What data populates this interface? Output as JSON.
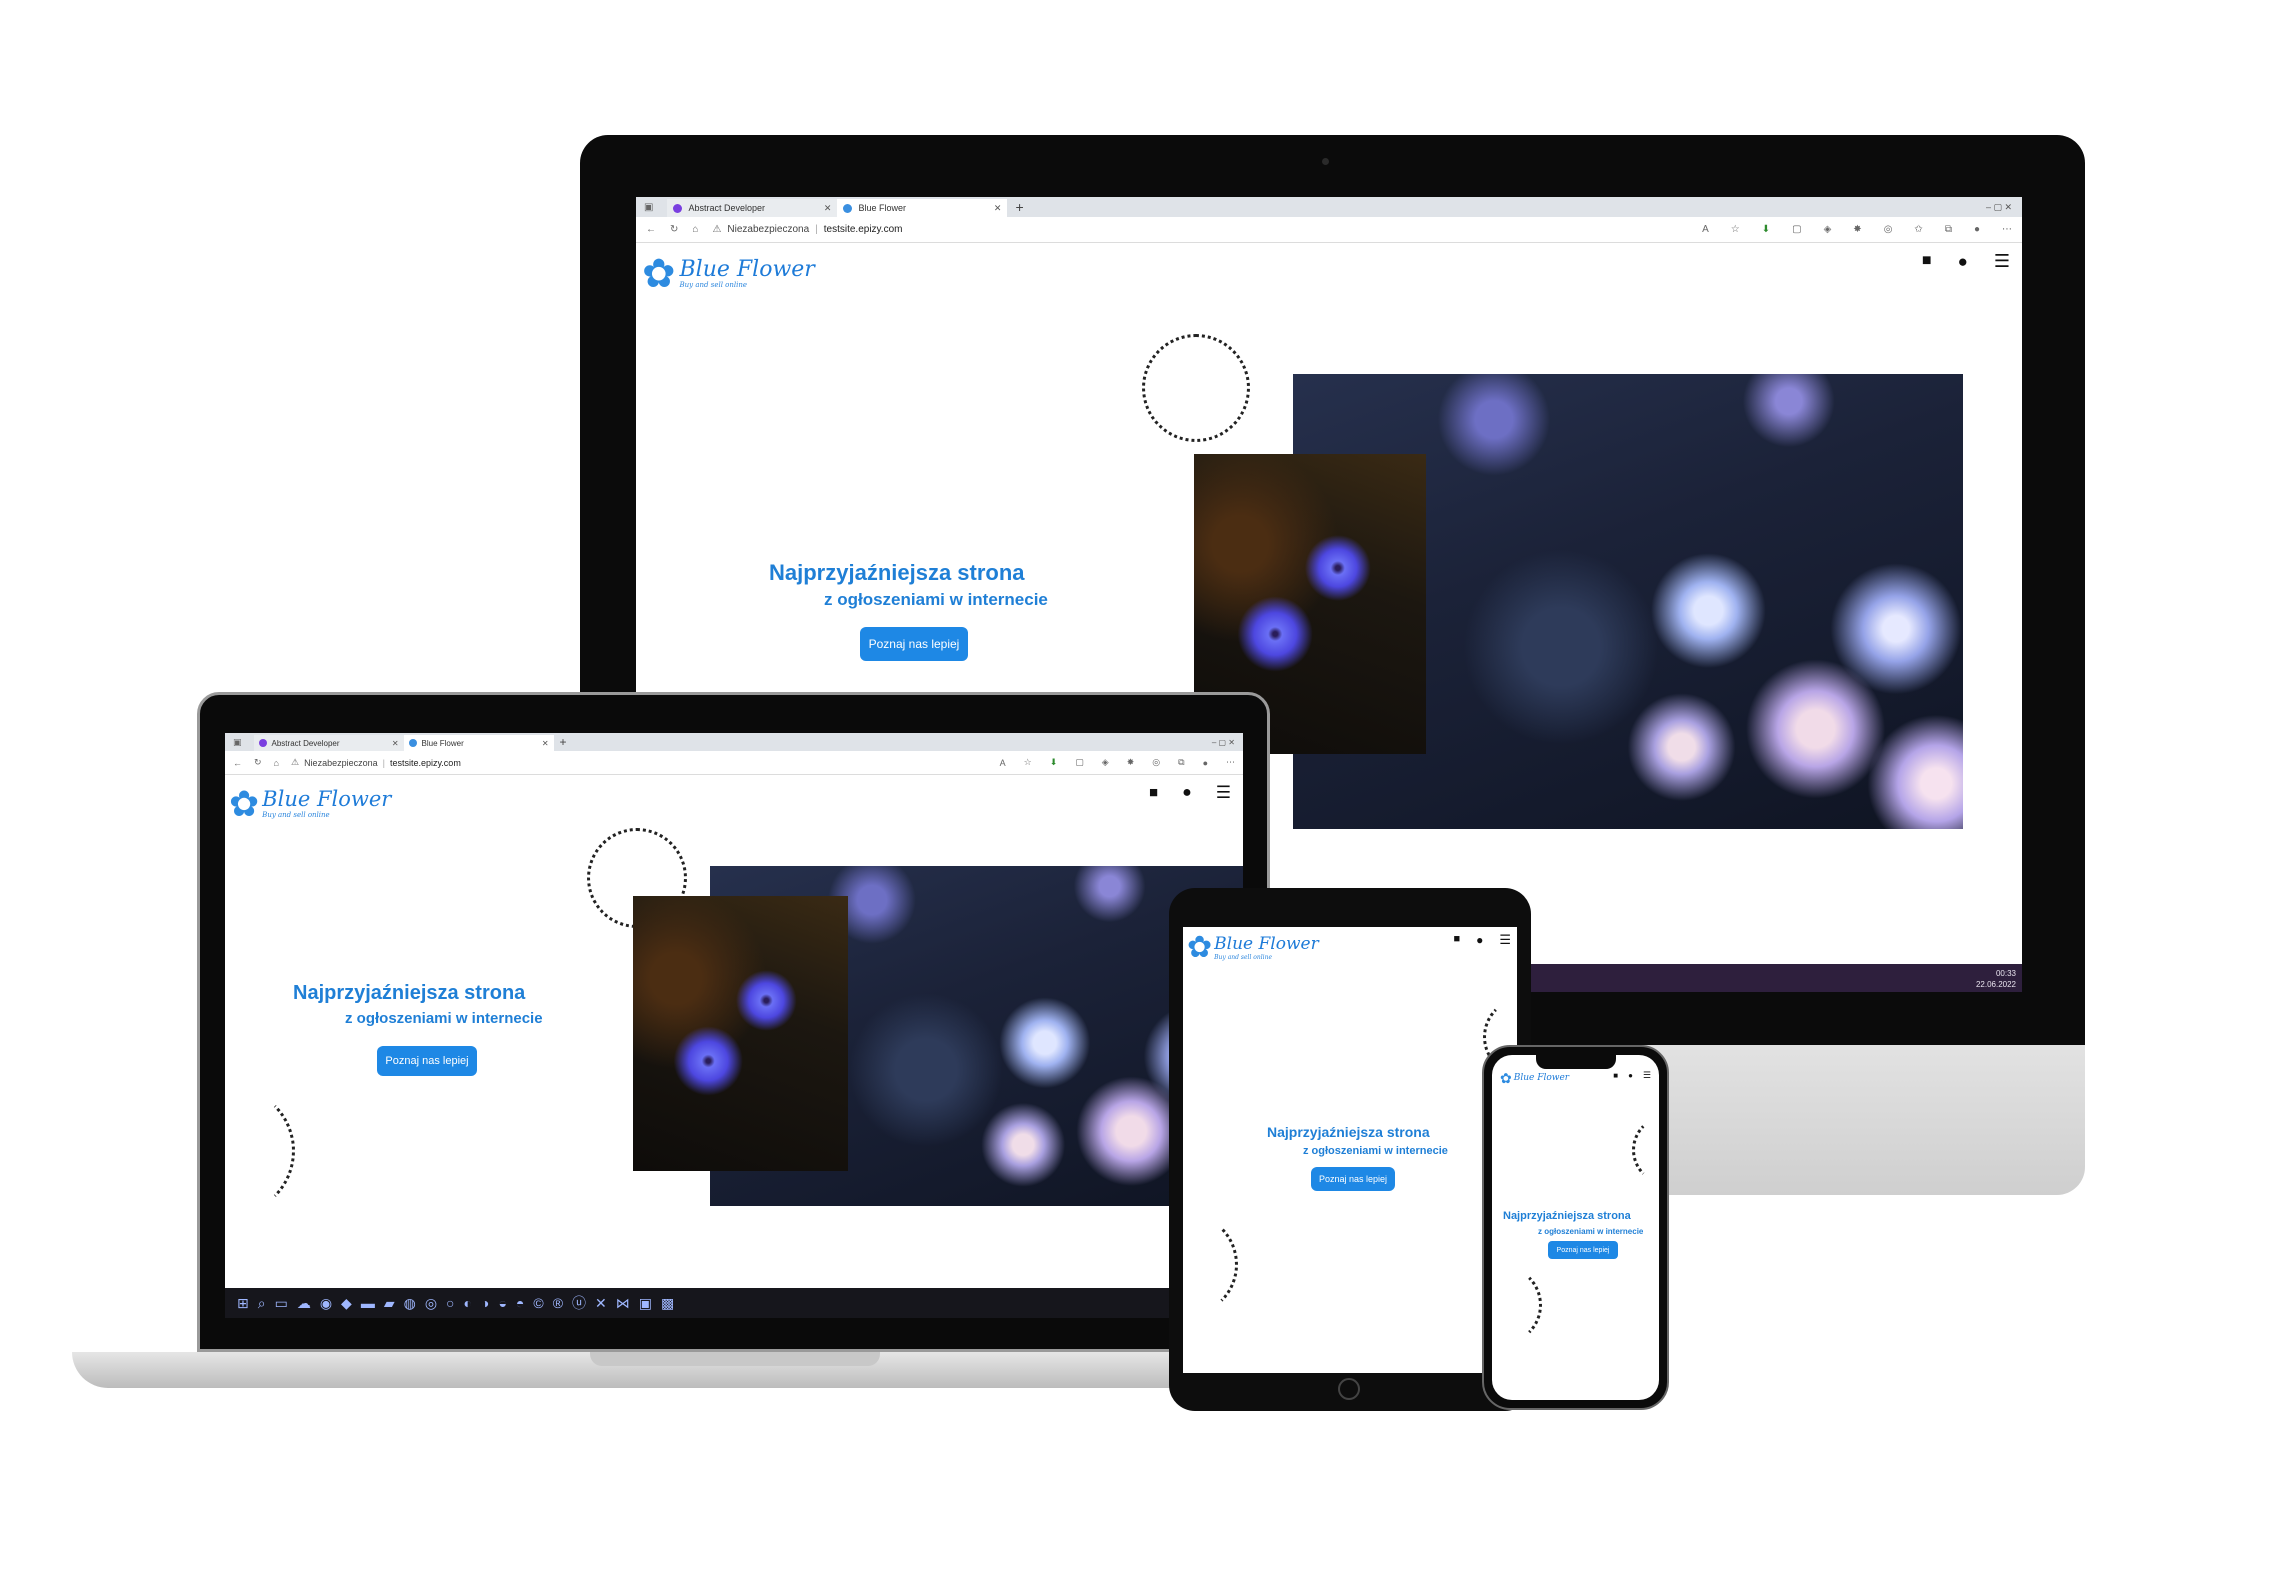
{
  "browser": {
    "tabs": [
      {
        "title": "Abstract Developer",
        "icon_color": "#7a3fe0"
      },
      {
        "title": "Blue Flower",
        "icon_color": "#3a8fe0"
      }
    ],
    "new_tab": "+",
    "security_label": "Niezabezpieczona",
    "url": "testsite.epizy.com",
    "window_controls": "–  ▢  ✕"
  },
  "site": {
    "logo_title": "Blue Flower",
    "logo_subtitle": "Buy and sell online",
    "hero_title": "Najprzyjaźniejsza strona",
    "hero_subtitle": "z ogłoszeniami w internecie",
    "cta_label": "Poznaj nas lepiej",
    "accent": "#1f7fd6",
    "button_color": "#1e88e5",
    "nav_icons": [
      "blog-icon",
      "user-icon",
      "hamburger-menu-icon"
    ]
  },
  "monitor": {
    "clock_time": "00:33",
    "clock_date": "22.06.2022"
  }
}
